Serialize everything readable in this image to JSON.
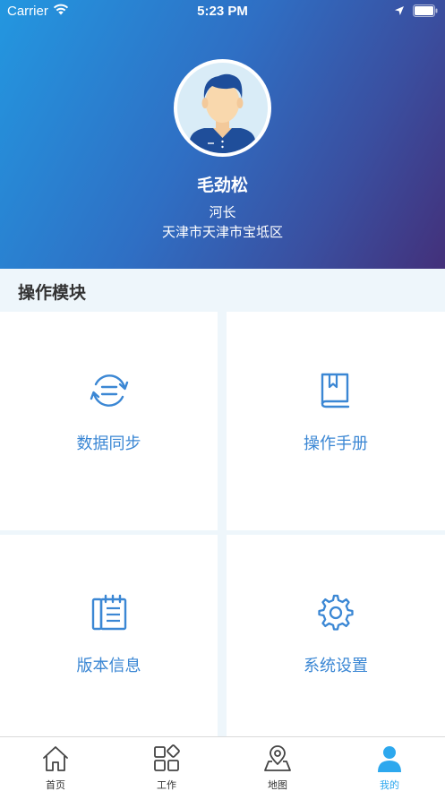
{
  "status_bar": {
    "carrier": "Carrier",
    "time": "5:23 PM"
  },
  "profile": {
    "name": "毛劲松",
    "role": "河长",
    "region": "天津市天津市宝坻区"
  },
  "section": {
    "title": "操作模块"
  },
  "modules": [
    {
      "label": "数据同步",
      "icon": "sync-icon"
    },
    {
      "label": "操作手册",
      "icon": "book-icon"
    },
    {
      "label": "版本信息",
      "icon": "notebook-icon"
    },
    {
      "label": "系统设置",
      "icon": "gear-icon"
    }
  ],
  "tabbar": {
    "items": [
      {
        "label": "首页",
        "icon": "home-icon"
      },
      {
        "label": "工作",
        "icon": "apps-icon"
      },
      {
        "label": "地图",
        "icon": "map-pin-icon"
      },
      {
        "label": "我的",
        "icon": "person-icon"
      }
    ],
    "active_index": 3
  },
  "colors": {
    "accent": "#3b87d4",
    "tab_active": "#2da8ee",
    "header_gradient_start": "#2397e0",
    "header_gradient_end": "#43307a"
  }
}
